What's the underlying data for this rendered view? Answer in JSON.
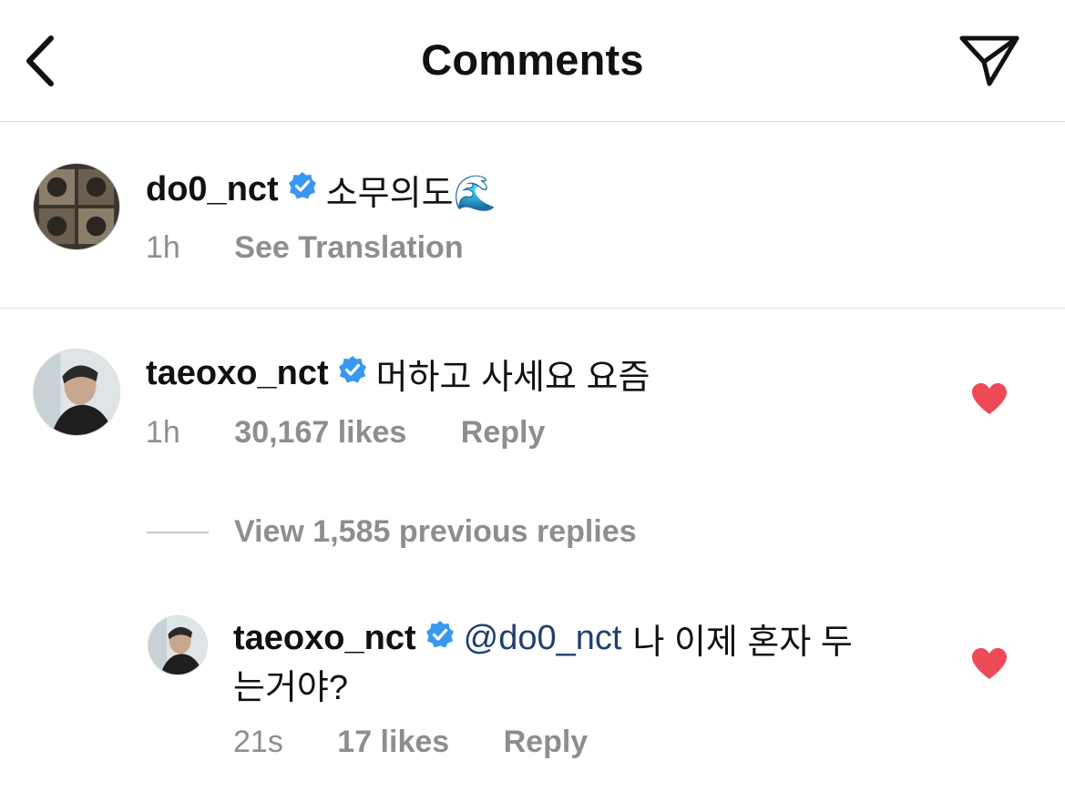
{
  "header": {
    "title": "Comments",
    "back_icon": "chevron-left-icon",
    "send_icon": "paper-plane-icon"
  },
  "caption": {
    "username": "do0_nct",
    "text": "소무의도🌊",
    "time": "1h",
    "see_translation": "See Translation"
  },
  "comment": {
    "username": "taeoxo_nct",
    "text": "머하고 사세요 요즘",
    "time": "1h",
    "likes": "30,167 likes",
    "reply": "Reply",
    "liked": true
  },
  "view_replies": "View 1,585 previous replies",
  "reply_item": {
    "username": "taeoxo_nct",
    "mention": "@do0_nct",
    "text_line1": "나 이제 혼자 두",
    "text_line2": "는거야?",
    "time": "21s",
    "likes": "17 likes",
    "reply": "Reply",
    "liked": true
  },
  "colors": {
    "heart": "#ed4956",
    "verified": "#3897f0",
    "muted": "#8e8e8e",
    "mention": "#1f3f6e"
  }
}
